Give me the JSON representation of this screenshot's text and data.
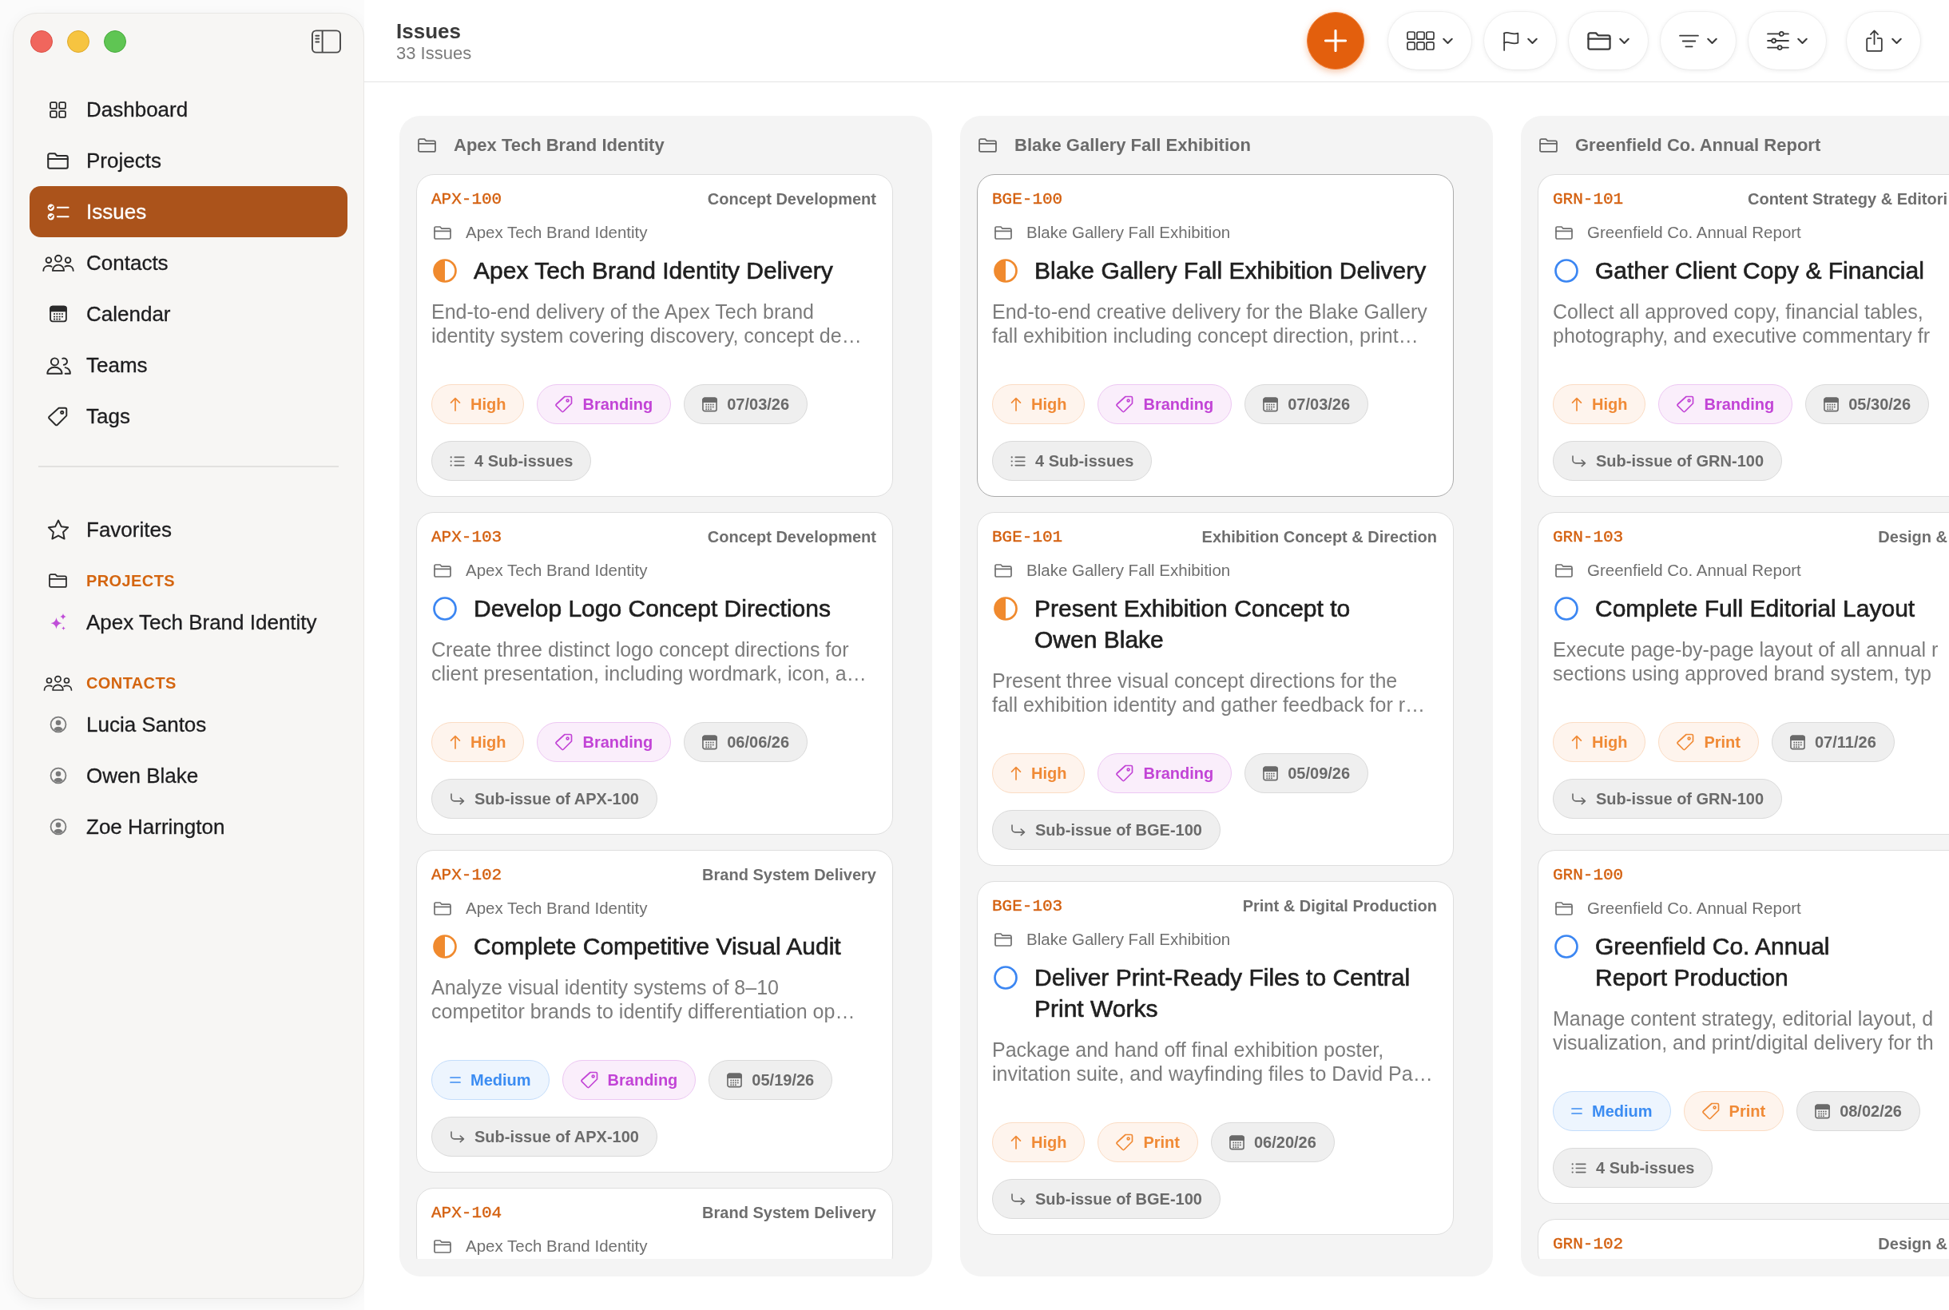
{
  "sidebar": {
    "nav": [
      {
        "label": "Dashboard",
        "selected": false
      },
      {
        "label": "Projects",
        "selected": false
      },
      {
        "label": "Issues",
        "selected": true
      },
      {
        "label": "Contacts",
        "selected": false
      },
      {
        "label": "Calendar",
        "selected": false
      },
      {
        "label": "Teams",
        "selected": false
      },
      {
        "label": "Tags",
        "selected": false
      }
    ],
    "favorites": {
      "label": "Favorites",
      "selected": false
    },
    "sections": [
      {
        "kind": "projects",
        "heading": "PROJECTS",
        "items": [
          {
            "label": "Apex Tech Brand Identity",
            "selected": false
          }
        ]
      },
      {
        "kind": "contacts",
        "heading": "CONTACTS",
        "items": [
          {
            "label": "Lucia Santos",
            "selected": false
          },
          {
            "label": "Owen Blake",
            "selected": false
          },
          {
            "label": "Zoe Harrington",
            "selected": false
          }
        ]
      }
    ]
  },
  "header": {
    "title": "Issues",
    "subtitle": "33 Issues"
  },
  "columns": [
    {
      "title": "Apex Tech Brand Identity",
      "cards": [
        {
          "id": "APX-100",
          "stage": "Concept Development",
          "project": "Apex Tech Brand Identity",
          "in_progress": true,
          "title": "Apex Tech Brand Identity Delivery",
          "description": [
            "End-to-end delivery of the Apex Tech brand",
            "identity system covering discovery, concept de…"
          ],
          "chips": [
            {
              "kind": "priority",
              "raised": true,
              "label": "High",
              "color": "#f08a36"
            },
            {
              "kind": "tag",
              "label": "Branding",
              "color": "#c244d6"
            },
            {
              "kind": "date",
              "label": "07/03/26"
            }
          ],
          "relation": {
            "kind": "subissues",
            "label": "4 Sub-issues"
          },
          "selected": false
        },
        {
          "id": "APX-103",
          "stage": "Concept Development",
          "project": "Apex Tech Brand Identity",
          "in_progress": false,
          "title": "Develop Logo Concept Directions",
          "description": [
            "Create three distinct logo concept directions for",
            "client presentation, including wordmark, icon, a…"
          ],
          "chips": [
            {
              "kind": "priority",
              "raised": true,
              "label": "High",
              "color": "#f08a36"
            },
            {
              "kind": "tag",
              "label": "Branding",
              "color": "#c244d6"
            },
            {
              "kind": "date",
              "label": "06/06/26"
            }
          ],
          "relation": {
            "kind": "parent",
            "label": "Sub-issue of APX-100"
          },
          "selected": false
        },
        {
          "id": "APX-102",
          "stage": "Brand System Delivery",
          "project": "Apex Tech Brand Identity",
          "in_progress": true,
          "title": "Complete Competitive Visual Audit",
          "description": [
            "Analyze visual identity systems of 8–10",
            "competitor brands to identify differentiation op…"
          ],
          "chips": [
            {
              "kind": "priority",
              "raised": false,
              "label": "Medium",
              "color": "#3b8cf2"
            },
            {
              "kind": "tag",
              "label": "Branding",
              "color": "#c244d6"
            },
            {
              "kind": "date",
              "label": "05/19/26"
            }
          ],
          "relation": {
            "kind": "parent",
            "label": "Sub-issue of APX-100"
          },
          "selected": false
        },
        {
          "id": "APX-104",
          "stage": "Brand System Delivery",
          "project": "Apex Tech Brand Identity",
          "selected": false
        }
      ]
    },
    {
      "title": "Blake Gallery Fall Exhibition",
      "cards": [
        {
          "id": "BGE-100",
          "project": "Blake Gallery Fall Exhibition",
          "in_progress": true,
          "title": "Blake Gallery Fall Exhibition Delivery",
          "description": [
            "End-to-end creative delivery for the Blake Gallery",
            "fall exhibition including concept direction, print…"
          ],
          "chips": [
            {
              "kind": "priority",
              "raised": true,
              "label": "High",
              "color": "#f08a36"
            },
            {
              "kind": "tag",
              "label": "Branding",
              "color": "#c244d6"
            },
            {
              "kind": "date",
              "label": "07/03/26"
            }
          ],
          "relation": {
            "kind": "subissues",
            "label": "4 Sub-issues"
          },
          "selected": true
        },
        {
          "id": "BGE-101",
          "stage": "Exhibition Concept & Direction",
          "project": "Blake Gallery Fall Exhibition",
          "in_progress": true,
          "title": "Present Exhibition Concept to Owen Blake",
          "description": [
            "Present three visual concept directions for the",
            "fall exhibition identity and gather feedback for r…"
          ],
          "chips": [
            {
              "kind": "priority",
              "raised": true,
              "label": "High",
              "color": "#f08a36"
            },
            {
              "kind": "tag",
              "label": "Branding",
              "color": "#c244d6"
            },
            {
              "kind": "date",
              "label": "05/09/26"
            }
          ],
          "relation": {
            "kind": "parent",
            "label": "Sub-issue of BGE-100"
          },
          "selected": false
        },
        {
          "id": "BGE-103",
          "stage": "Print & Digital Production",
          "project": "Blake Gallery Fall Exhibition",
          "in_progress": false,
          "title": "Deliver Print-Ready Files to Central Print Works",
          "description": [
            "Package and hand off final exhibition poster,",
            "invitation suite, and wayfinding files to David Pa…"
          ],
          "chips": [
            {
              "kind": "priority",
              "raised": true,
              "label": "High",
              "color": "#f08a36"
            },
            {
              "kind": "tag",
              "label": "Print",
              "color": "#f08a36"
            },
            {
              "kind": "date",
              "label": "06/20/26"
            }
          ],
          "relation": {
            "kind": "parent",
            "label": "Sub-issue of BGE-100"
          },
          "selected": false
        }
      ]
    },
    {
      "title": "Greenfield Co. Annual Report",
      "cards": [
        {
          "id": "GRN-101",
          "stage": "Content Strategy & Editori",
          "project": "Greenfield Co. Annual Report",
          "in_progress": false,
          "title": "Gather Client Copy & Financial",
          "description": [
            "Collect all approved copy, financial tables,",
            "photography, and executive commentary fr"
          ],
          "chips": [
            {
              "kind": "priority",
              "raised": true,
              "label": "High",
              "color": "#f08a36"
            },
            {
              "kind": "tag",
              "label": "Branding",
              "color": "#c244d6"
            },
            {
              "kind": "date",
              "label": "05/30/26"
            }
          ],
          "relation": {
            "kind": "parent",
            "label": "Sub-issue of GRN-100"
          },
          "selected": false
        },
        {
          "id": "GRN-103",
          "stage": "Design &",
          "project": "Greenfield Co. Annual Report",
          "in_progress": false,
          "title": "Complete Full Editorial Layout",
          "description": [
            "Execute page-by-page layout of all annual r",
            "sections using approved brand system, typ"
          ],
          "chips": [
            {
              "kind": "priority",
              "raised": true,
              "label": "High",
              "color": "#f08a36"
            },
            {
              "kind": "tag",
              "label": "Print",
              "color": "#f08a36"
            },
            {
              "kind": "date",
              "label": "07/11/26"
            }
          ],
          "relation": {
            "kind": "parent",
            "label": "Sub-issue of GRN-100"
          },
          "selected": false
        },
        {
          "id": "GRN-100",
          "project": "Greenfield Co. Annual Report",
          "in_progress": false,
          "title": "Greenfield Co. Annual Report Production",
          "description": [
            "Manage content strategy, editorial layout, d",
            "visualization, and print/digital delivery for th"
          ],
          "chips": [
            {
              "kind": "priority",
              "raised": false,
              "label": "Medium",
              "color": "#3b8cf2"
            },
            {
              "kind": "tag",
              "label": "Print",
              "color": "#f08a36"
            },
            {
              "kind": "date",
              "label": "08/02/26"
            }
          ],
          "relation": {
            "kind": "subissues",
            "label": "4 Sub-issues"
          },
          "selected": false
        },
        {
          "id": "GRN-102",
          "stage": "Design &",
          "selected": false
        }
      ]
    }
  ]
}
